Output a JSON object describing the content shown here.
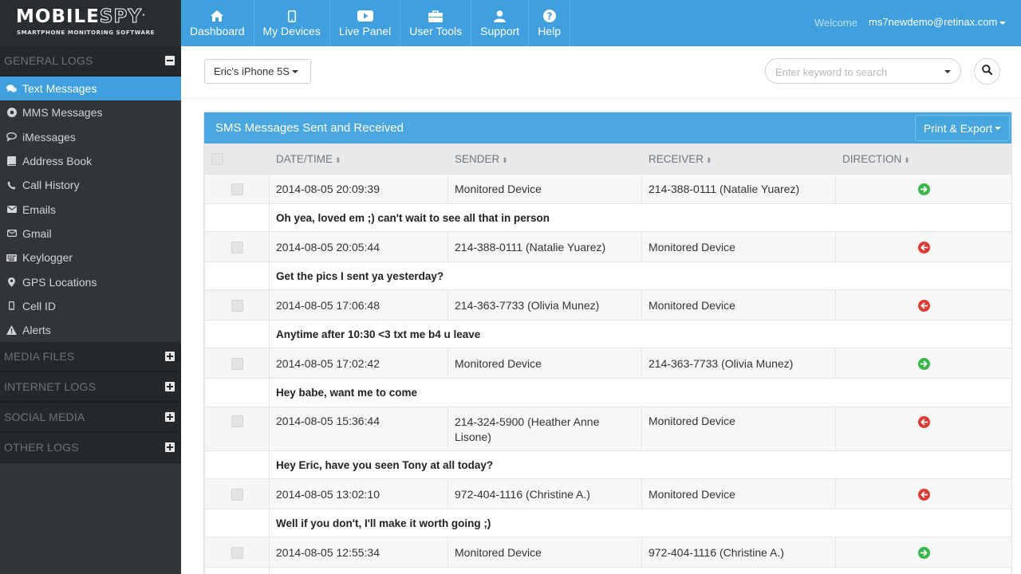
{
  "app": {
    "logo_main": "MOBILE",
    "logo_accent": "SPY",
    "logo_dot": ".",
    "tagline": "SMARTPHONE MONITORING SOFTWARE"
  },
  "nav": {
    "items": [
      {
        "label": "Dashboard",
        "icon": "home-icon"
      },
      {
        "label": "My Devices",
        "icon": "mobile-icon"
      },
      {
        "label": "Live Panel",
        "icon": "play-icon"
      },
      {
        "label": "User Tools",
        "icon": "briefcase-icon"
      },
      {
        "label": "Support",
        "icon": "user-icon"
      },
      {
        "label": "Help",
        "icon": "question-icon"
      }
    ],
    "welcome": "Welcome",
    "user": "ms7newdemo@retinax.com"
  },
  "sidebar": {
    "general_logs": "GENERAL LOGS",
    "items": [
      {
        "label": "Text Messages",
        "icon": "comments-icon"
      },
      {
        "label": "MMS Messages",
        "icon": "circle-icon"
      },
      {
        "label": "iMessages",
        "icon": "speech-bubble-icon"
      },
      {
        "label": "Address Book",
        "icon": "book-icon"
      },
      {
        "label": "Call History",
        "icon": "phone-icon"
      },
      {
        "label": "Emails",
        "icon": "envelope-icon"
      },
      {
        "label": "Gmail",
        "icon": "envelope-outline-icon"
      },
      {
        "label": "Keylogger",
        "icon": "keyboard-icon"
      },
      {
        "label": "GPS Locations",
        "icon": "map-marker-icon"
      },
      {
        "label": "Cell ID",
        "icon": "cell-phone-icon"
      },
      {
        "label": "Alerts",
        "icon": "warning-icon"
      }
    ],
    "collapsed_sections": [
      "MEDIA FILES",
      "INTERNET LOGS",
      "SOCIAL MEDIA",
      "OTHER LOGS"
    ]
  },
  "toolbar": {
    "device": "Eric's iPhone 5S",
    "search_placeholder": "Enter keyword to search"
  },
  "panel": {
    "title": "SMS Messages Sent and Received",
    "export_label": "Print & Export",
    "columns": [
      "DATE/TIME",
      "SENDER",
      "RECEIVER",
      "DIRECTION"
    ],
    "sort_glyph": "⬍",
    "rows": [
      {
        "datetime": "2014-08-05 20:09:39",
        "sender": "Monitored Device",
        "receiver": "214-388-0111 (Natalie Yuarez)",
        "direction": "outgoing",
        "message": "Oh yea, loved em ;) can't wait to see all that in person"
      },
      {
        "datetime": "2014-08-05 20:05:44",
        "sender": "214-388-0111 (Natalie Yuarez)",
        "receiver": "Monitored Device",
        "direction": "incoming",
        "message": "Get the pics I sent ya yesterday?"
      },
      {
        "datetime": "2014-08-05 17:06:48",
        "sender": "214-363-7733 (Olivia Munez)",
        "receiver": "Monitored Device",
        "direction": "incoming",
        "message": "Anytime after 10:30 <3 txt me b4 u leave"
      },
      {
        "datetime": "2014-08-05 17:02:42",
        "sender": "Monitored Device",
        "receiver": "214-363-7733 (Olivia Munez)",
        "direction": "outgoing",
        "message": "Hey babe, want me to come"
      },
      {
        "datetime": "2014-08-05 15:36:44",
        "sender": "214-324-5900 (Heather Anne Lisone)",
        "receiver": "Monitored Device",
        "direction": "incoming",
        "message": "Hey Eric, have you seen Tony at all today?"
      },
      {
        "datetime": "2014-08-05 13:02:10",
        "sender": "972-404-1116 (Christine A.)",
        "receiver": "Monitored Device",
        "direction": "incoming",
        "message": "Well if you don't, I'll make it worth going ;)"
      },
      {
        "datetime": "2014-08-05 12:55:34",
        "sender": "Monitored Device",
        "receiver": "972-404-1116 (Christine A.)",
        "direction": "outgoing",
        "message": ""
      }
    ]
  },
  "colors": {
    "accent": "#3fa0dd",
    "sidebar": "#313539",
    "outgoing": "#3ab54a",
    "incoming": "#dd3b34"
  }
}
